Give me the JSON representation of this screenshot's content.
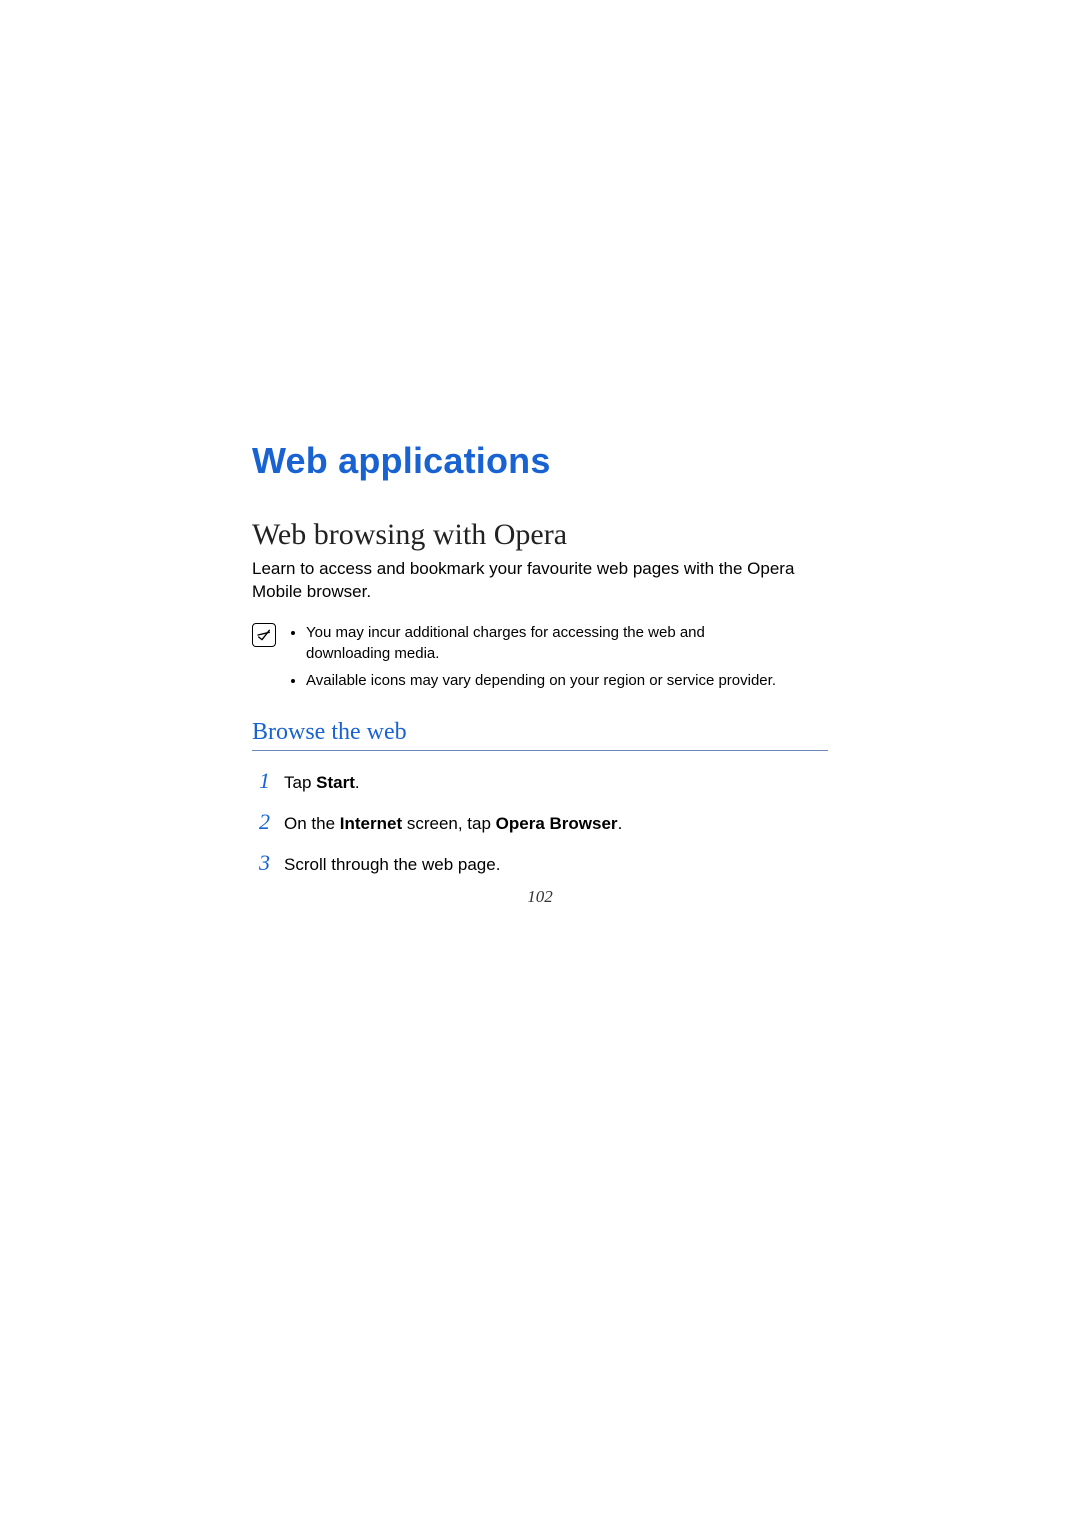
{
  "chapter_title": "Web applications",
  "section": {
    "title": "Web browsing with Opera",
    "description": "Learn to access and bookmark your favourite web pages with the Opera Mobile browser."
  },
  "notes": [
    "You may incur additional charges for accessing the web and downloading media.",
    "Available icons may vary depending on your region or service provider."
  ],
  "subsection": {
    "title": "Browse the web",
    "steps": [
      {
        "num": "1",
        "prefix": "Tap ",
        "bold1": "Start",
        "mid": ".",
        "bold2": "",
        "suffix": ""
      },
      {
        "num": "2",
        "prefix": "On the ",
        "bold1": "Internet",
        "mid": " screen, tap ",
        "bold2": "Opera Browser",
        "suffix": "."
      },
      {
        "num": "3",
        "prefix": "Scroll through the web page.",
        "bold1": "",
        "mid": "",
        "bold2": "",
        "suffix": ""
      }
    ]
  },
  "page_number": "102"
}
